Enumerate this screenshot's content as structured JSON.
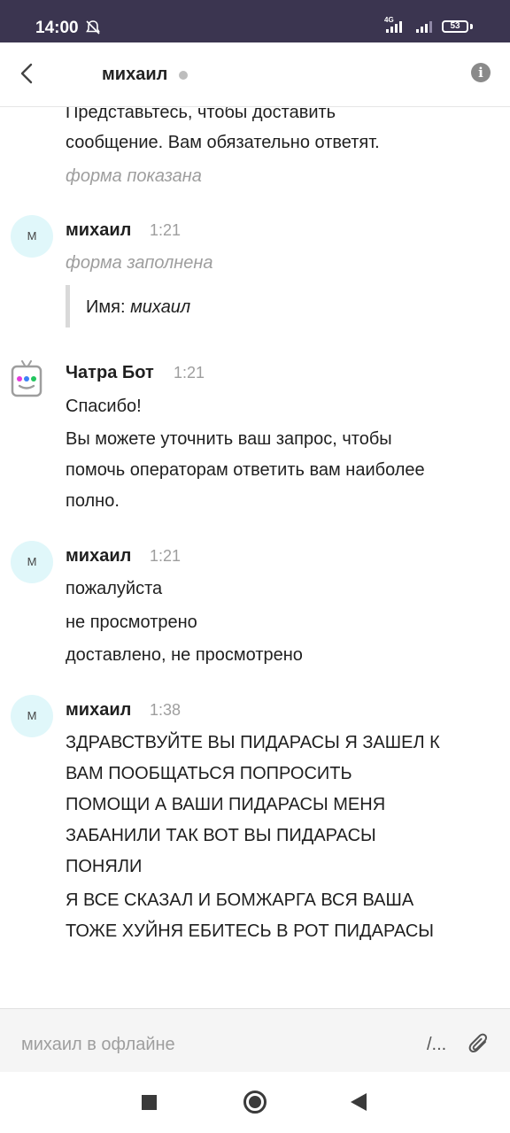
{
  "status": {
    "time": "14:00",
    "net": "4G",
    "battery": "53"
  },
  "header": {
    "title": "михаил"
  },
  "chat": {
    "top_line1": "Представьтесь, чтобы доставить",
    "top_line2": "сообщение. Вам обязательно ответят.",
    "top_status": "форма показана",
    "m1": {
      "avatar": "М",
      "name": "михаил",
      "time": "1:21",
      "status": "форма заполнена",
      "quote_label": "Имя:",
      "quote_value": "михаил"
    },
    "m2": {
      "name": "Чатра Бот",
      "time": "1:21",
      "line1": "Спасибо!",
      "line2": "Вы можете уточнить ваш запрос, чтобы",
      "line3": "помочь операторам ответить вам наиболее",
      "line4": "полно."
    },
    "m3": {
      "avatar": "М",
      "name": "михаил",
      "time": "1:21",
      "line1": "пожалуйста",
      "line2": "не просмотрено",
      "line3": "доставлено, не просмотрено"
    },
    "m4": {
      "avatar": "М",
      "name": "михаил",
      "time": "1:38",
      "line1": "ЗДРАВСТВУЙТЕ ВЫ ПИДАРАСЫ Я ЗАШЕЛ К",
      "line2": "ВАМ ПООБЩАТЬСЯ ПОПРОСИТЬ",
      "line3": "ПОМОЩИ А ВАШИ ПИДАРАСЫ МЕНЯ",
      "line4": "ЗАБАНИЛИ ТАК ВОТ ВЫ ПИДАРАСЫ",
      "line5": "ПОНЯЛИ",
      "line6": "Я ВСЕ СКАЗАЛ И БОМЖАРГА ВСЯ ВАША",
      "line7": "ТОЖЕ ХУЙНЯ ЕБИТЕСЬ В РОТ ПИДАРАСЫ"
    }
  },
  "composer": {
    "placeholder": "михаил в офлайне",
    "commands": "/..."
  },
  "icons": [
    "back-arrow-icon",
    "info-icon",
    "bell-off-icon",
    "signal-icon",
    "battery-icon",
    "bot-icon",
    "paperclip-icon",
    "nav-recents-icon",
    "nav-home-icon",
    "nav-back-icon"
  ],
  "colors": {
    "status_bar": "#3b3550",
    "avatar_bg": "#e0f7fa",
    "muted": "#9e9e9e"
  }
}
